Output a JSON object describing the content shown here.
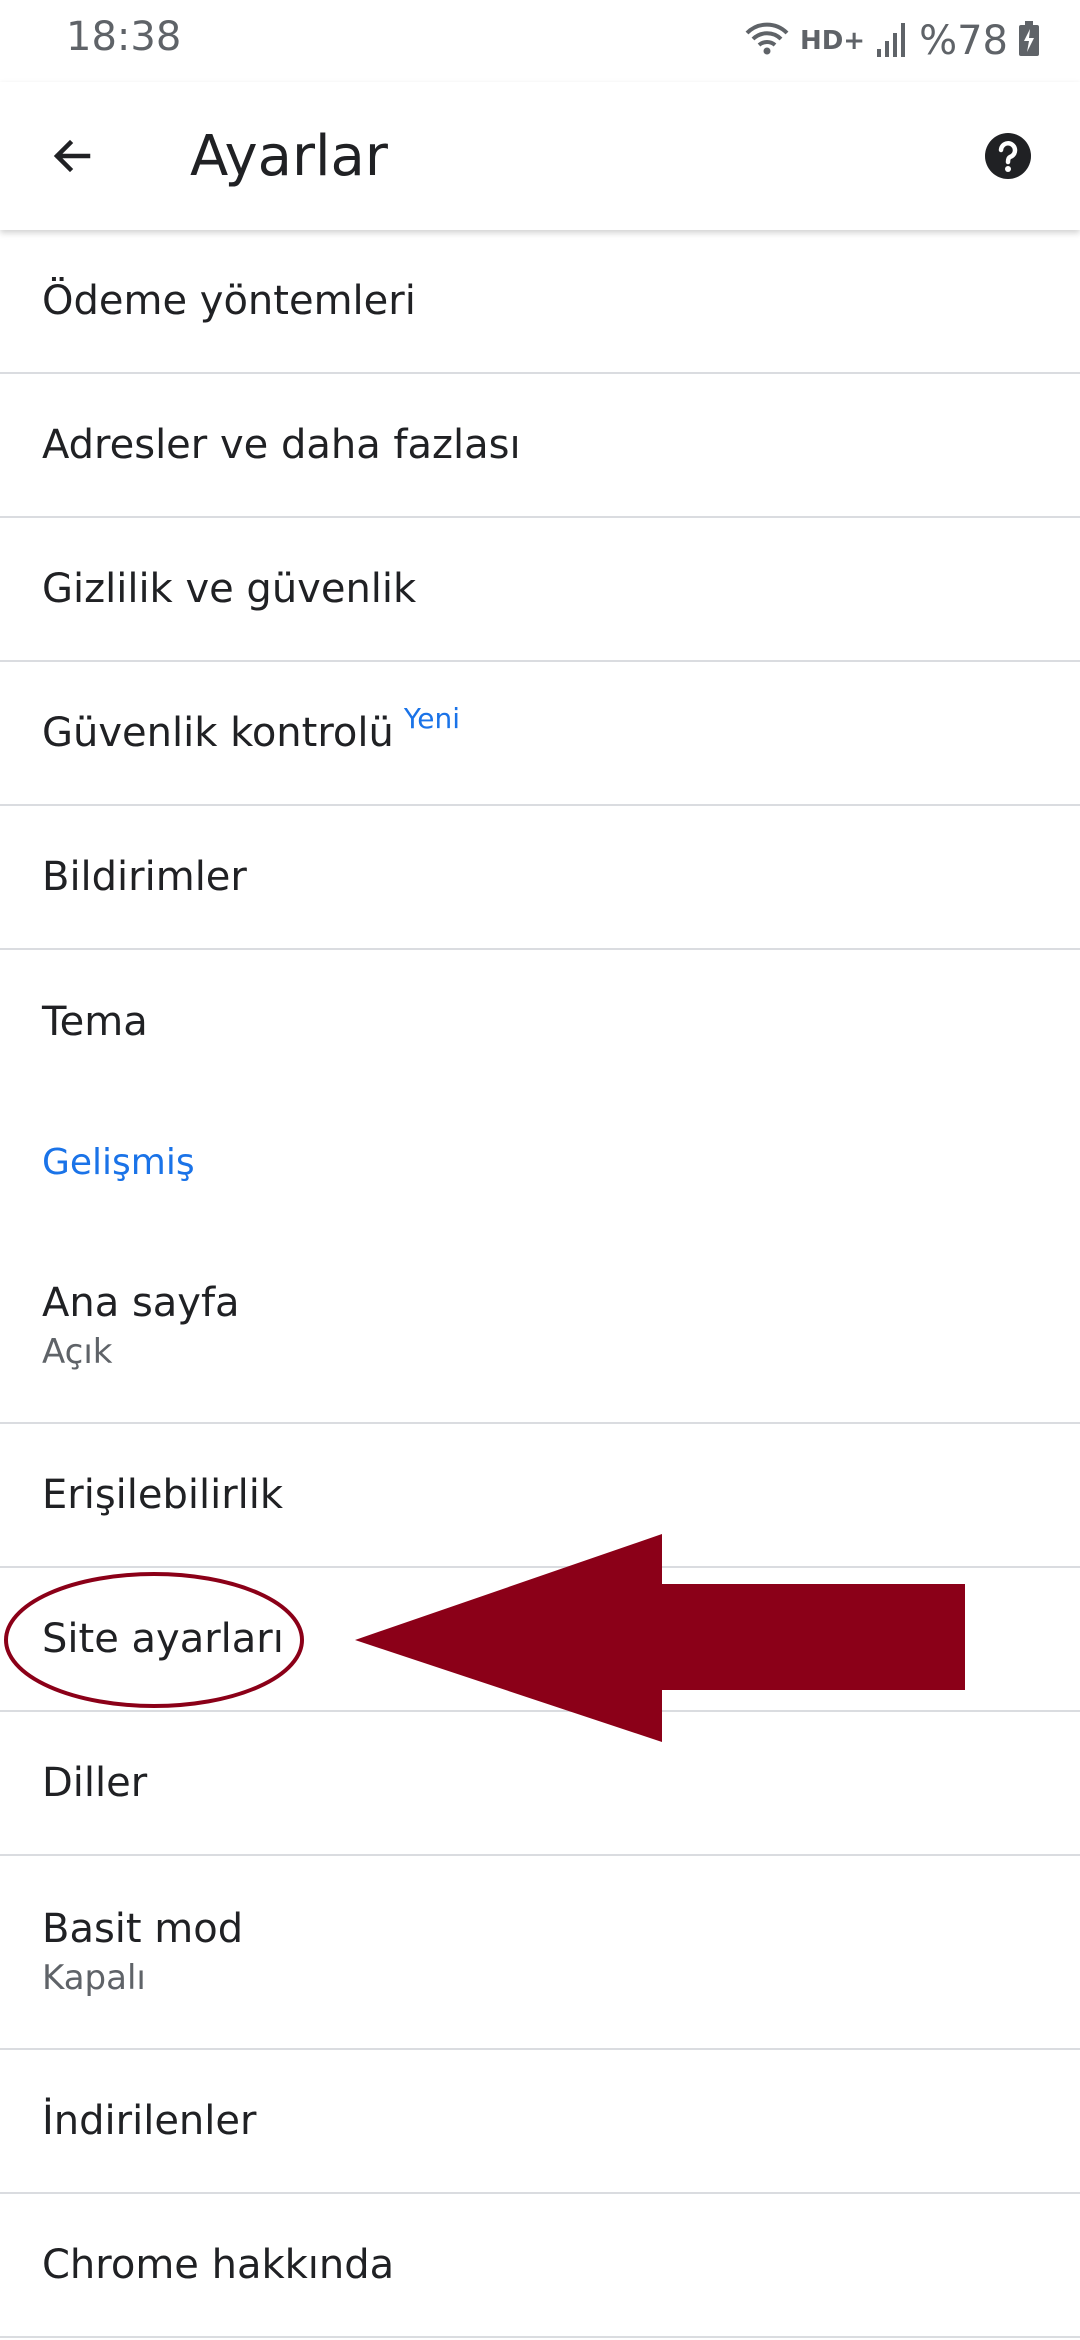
{
  "status_bar": {
    "time": "18:38",
    "network": "HD+",
    "battery": "%78"
  },
  "app_bar": {
    "title": "Ayarlar"
  },
  "settings": {
    "payment_methods": "Ödeme yöntemleri",
    "addresses": "Adresler ve daha fazlası",
    "privacy": "Gizlilik ve güvenlik",
    "safety_check": "Güvenlik kontrolü",
    "safety_check_badge": "Yeni",
    "notifications": "Bildirimler",
    "theme": "Tema",
    "advanced_header": "Gelişmiş",
    "homepage": "Ana sayfa",
    "homepage_state": "Açık",
    "accessibility": "Erişilebilirlik",
    "site_settings": "Site ayarları",
    "languages": "Diller",
    "lite_mode": "Basit mod",
    "lite_mode_state": "Kapalı",
    "downloads": "İndirilenler",
    "about_chrome": "Chrome hakkında"
  },
  "colors": {
    "accent": "#1a73e8",
    "annotation": "#8b0018",
    "divider": "#dadce0"
  },
  "icons": {
    "back": "arrow-back-icon",
    "help": "help-circle-icon",
    "wifi": "wifi-icon",
    "signal": "signal-icon",
    "battery": "battery-charging-icon"
  }
}
